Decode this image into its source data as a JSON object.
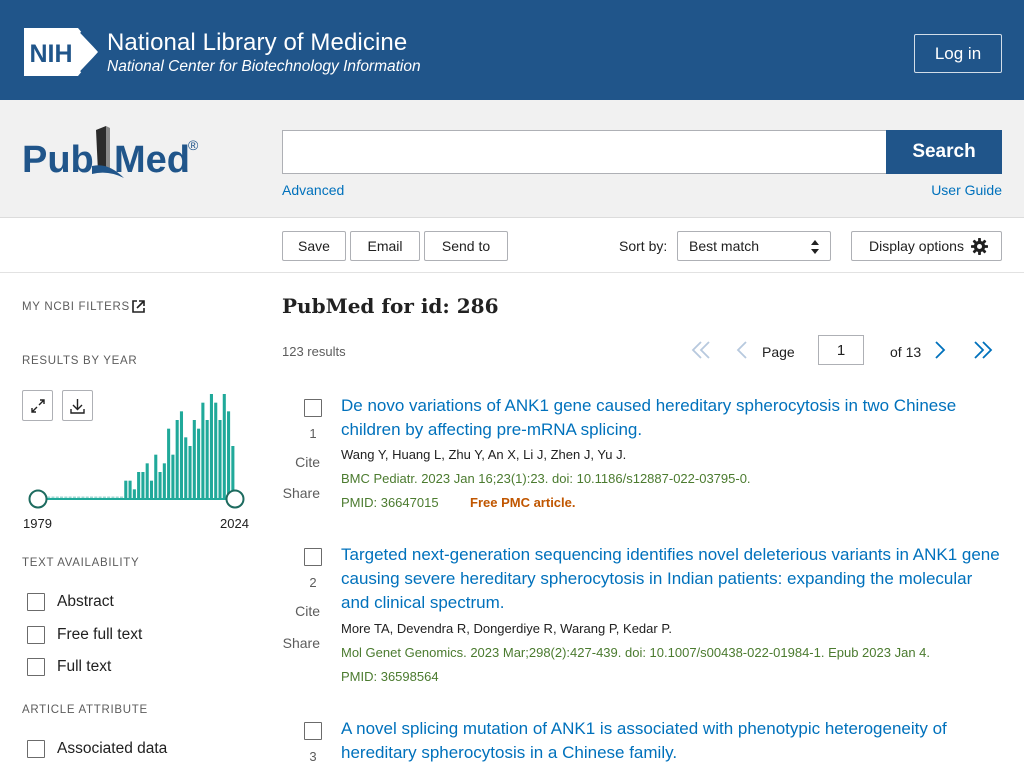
{
  "header": {
    "logo_text": "NIH",
    "title": "National Library of Medicine",
    "subtitle": "National Center for Biotechnology Information",
    "login": "Log in"
  },
  "search": {
    "logo_text_pub": "Pub",
    "logo_text_med": "Med",
    "logo_reg": "®",
    "query": "",
    "button": "Search",
    "advanced": "Advanced",
    "user_guide": "User Guide"
  },
  "toolbar": {
    "save": "Save",
    "email": "Email",
    "send_to": "Send to",
    "sort_label": "Sort by:",
    "sort_value": "Best match",
    "display_options": "Display options"
  },
  "sidebar": {
    "my_ncbi_filters": "MY NCBI FILTERS",
    "results_by_year": "RESULTS BY YEAR",
    "year_start": "1979",
    "year_end": "2024",
    "text_availability": "TEXT AVAILABILITY",
    "text_filters": [
      "Abstract",
      "Free full text",
      "Full text"
    ],
    "article_attribute": "ARTICLE ATTRIBUTE",
    "attribute_filters": [
      "Associated data"
    ]
  },
  "chart_data": {
    "type": "bar",
    "title": "",
    "xlabel": "",
    "ylabel": "",
    "x_range": [
      1979,
      2024
    ],
    "ylim": [
      0,
      12
    ],
    "values": [
      0,
      0,
      0,
      0,
      0,
      0,
      0,
      0,
      0,
      0,
      0,
      0,
      0,
      0,
      0,
      0,
      0,
      0,
      0,
      0,
      2,
      2,
      1,
      3,
      3,
      4,
      2,
      5,
      3,
      4,
      8,
      5,
      9,
      10,
      7,
      6,
      9,
      8,
      11,
      9,
      12,
      11,
      9,
      12,
      10,
      6
    ]
  },
  "results": {
    "title": "PubMed for id: 286",
    "count": "123 results",
    "page_label": "Page",
    "page_value": "1",
    "page_of": "of 13",
    "items": [
      {
        "num": "1",
        "title": "De novo variations of ANK1 gene caused hereditary spherocytosis in two Chinese children by affecting pre-mRNA splicing.",
        "authors": "Wang Y, Huang L, Zhu Y, An X, Li J, Zhen J, Yu J.",
        "citation": "BMC Pediatr. 2023 Jan 16;23(1):23. doi: 10.1186/s12887-022-03795-0.",
        "pmid": "PMID: 36647015",
        "free": "Free PMC article.",
        "cite": "Cite",
        "share": "Share"
      },
      {
        "num": "2",
        "title": "Targeted next-generation sequencing identifies novel deleterious variants in ANK1 gene causing severe hereditary spherocytosis in Indian patients: expanding the molecular and clinical spectrum.",
        "authors": "More TA, Devendra R, Dongerdiye R, Warang P, Kedar P.",
        "citation": "Mol Genet Genomics. 2023 Mar;298(2):427-439. doi: 10.1007/s00438-022-01984-1. Epub 2023 Jan 4.",
        "pmid": "PMID: 36598564",
        "cite": "Cite",
        "share": "Share"
      },
      {
        "num": "3",
        "title": "A novel splicing mutation of ANK1 is associated with phenotypic heterogeneity of hereditary spherocytosis in a Chinese family."
      }
    ]
  },
  "colors": {
    "nih_blue": "#20558a",
    "link": "#0071bc",
    "chart_teal": "#20a99a",
    "citation_green": "#4b7b2f",
    "free_orange": "#c05600"
  }
}
